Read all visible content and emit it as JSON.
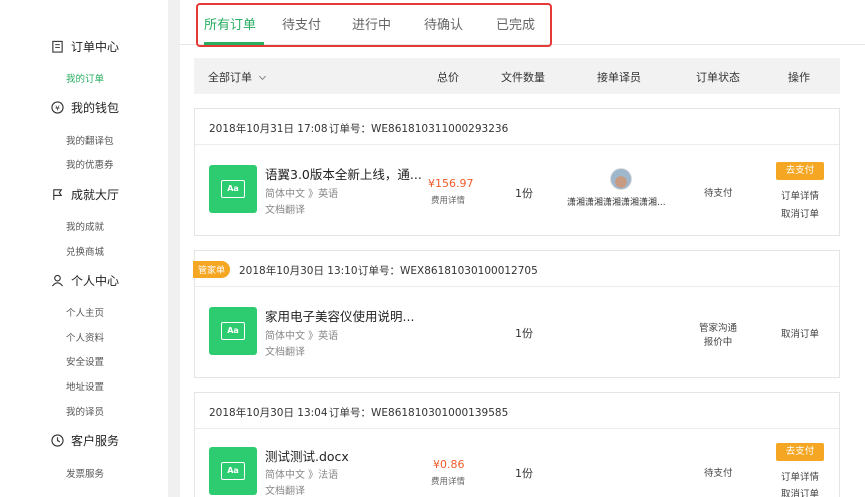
{
  "sidebar": {
    "sections": [
      {
        "label": "订单中心",
        "icon": "clipboard-icon",
        "items": [
          {
            "label": "我的订单",
            "active": true
          }
        ]
      },
      {
        "label": "我的钱包",
        "icon": "yen-icon",
        "items": [
          {
            "label": "我的翻译包"
          },
          {
            "label": "我的优惠券"
          }
        ]
      },
      {
        "label": "成就大厅",
        "icon": "flag-icon",
        "items": [
          {
            "label": "我的成就"
          },
          {
            "label": "兑换商城"
          }
        ]
      },
      {
        "label": "个人中心",
        "icon": "person-icon",
        "items": [
          {
            "label": "个人主页"
          },
          {
            "label": "个人资料"
          },
          {
            "label": "安全设置"
          },
          {
            "label": "地址设置"
          },
          {
            "label": "我的译员"
          }
        ]
      },
      {
        "label": "客户服务",
        "icon": "clock-icon",
        "items": [
          {
            "label": "发票服务"
          }
        ]
      }
    ]
  },
  "tabs": [
    "所有订单",
    "待支付",
    "进行中",
    "待确认",
    "已完成"
  ],
  "table_header": {
    "all_orders": "全部订单",
    "total": "总价",
    "file_count": "文件数量",
    "translator": "接单译员",
    "status": "订单状态",
    "action": "操作"
  },
  "orders": [
    {
      "date": "2018年10月31日 17:08",
      "order_no": "订单号：WE861810311000293236",
      "badge": "",
      "title": "语翼3.0版本全新上线，通...",
      "lang": "简体中文 》英语",
      "category": "文档翻译",
      "price": "¥156.97",
      "fee": "费用详情",
      "count": "1份",
      "translator": "潇湘潇湘潇湘潇湘潇湘...",
      "status": "待支付",
      "pay": "去支付",
      "links": [
        "订单详情",
        "取消订单"
      ]
    },
    {
      "date": "2018年10月30日 13:10",
      "order_no": "订单号：WEX86181030100012705",
      "badge": "管家单",
      "title": "家用电子美容仪使用说明...",
      "lang": "简体中文 》英语",
      "category": "文档翻译",
      "count": "1份",
      "status_lines": [
        "管家沟通",
        "报价中"
      ],
      "links": [
        "取消订单"
      ]
    },
    {
      "date": "2018年10月30日 13:04",
      "order_no": "订单号：WE861810301000139585",
      "badge": "",
      "title": "测试测试.docx",
      "lang": "简体中文 》法语",
      "category": "文档翻译",
      "price": "¥0.86",
      "fee": "费用详情",
      "count": "1份",
      "status": "待支付",
      "pay": "去支付",
      "links": [
        "订单详情",
        "取消订单"
      ]
    }
  ],
  "doc_icon_text": "Aa"
}
